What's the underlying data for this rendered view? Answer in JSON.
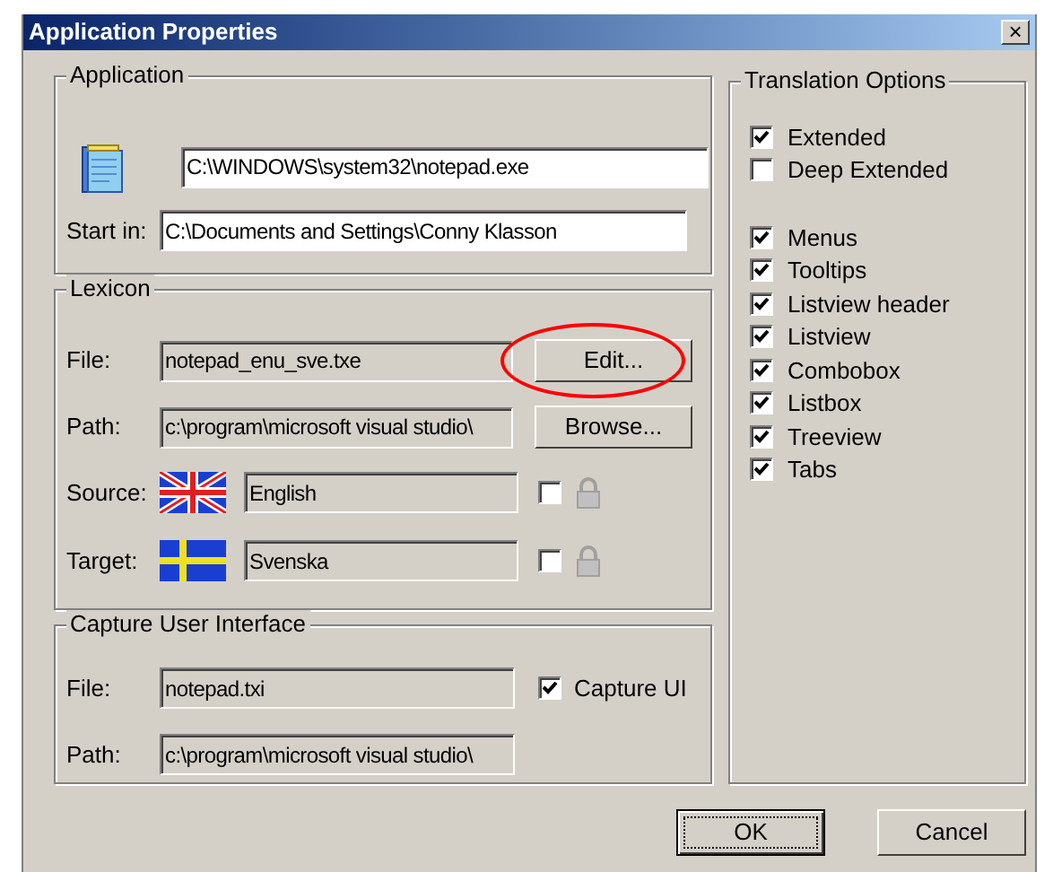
{
  "window": {
    "title": "Application Properties",
    "close": "×"
  },
  "application": {
    "title": "Application",
    "exe": "C:\\WINDOWS\\system32\\notepad.exe",
    "start_in_label": "Start in:",
    "start_in": "C:\\Documents and Settings\\Conny Klasson"
  },
  "lexicon": {
    "title": "Lexicon",
    "file_label": "File:",
    "file": "notepad_enu_sve.txe",
    "edit_button": {
      "label": "Edit...",
      "circled": true
    },
    "path_label": "Path:",
    "path": "c:\\program\\microsoft visual studio\\",
    "browse_button": "Browse...",
    "languages": [
      {
        "label": "Source:",
        "kind": "uk",
        "value": "English",
        "checked": false
      },
      {
        "label": "Target:",
        "kind": "se",
        "value": "Svenska",
        "checked": false
      }
    ]
  },
  "capture": {
    "title": "Capture User Interface",
    "file_label": "File:",
    "file": "notepad.txi",
    "capture_ui": {
      "label": "Capture UI",
      "checked": true
    },
    "path_label": "Path:",
    "path": "c:\\program\\microsoft visual studio\\"
  },
  "translation_options": {
    "title": "Translation Options",
    "groups": [
      [
        {
          "label": "Extended",
          "checked": true
        },
        {
          "label": "Deep Extended",
          "checked": false
        }
      ],
      [
        {
          "label": "Menus",
          "checked": true
        },
        {
          "label": "Tooltips",
          "checked": true
        },
        {
          "label": "Listview header",
          "checked": true
        },
        {
          "label": "Listview",
          "checked": true
        },
        {
          "label": "Combobox",
          "checked": true
        },
        {
          "label": "Listbox",
          "checked": true
        },
        {
          "label": "Treeview",
          "checked": true
        },
        {
          "label": "Tabs",
          "checked": true
        }
      ]
    ]
  },
  "buttons": [
    {
      "label": "OK",
      "default": true
    },
    {
      "label": "Cancel",
      "default": false
    }
  ]
}
